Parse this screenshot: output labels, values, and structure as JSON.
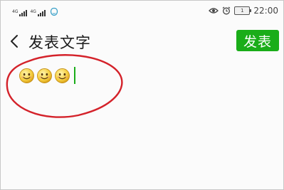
{
  "status_bar": {
    "sim1_label": "4G",
    "sim2_label": "4G",
    "time": "22:00",
    "battery_level": "1",
    "icons": [
      "signal-icon",
      "signal-icon",
      "chat-notification-icon",
      "eye-icon",
      "alarm-icon",
      "battery-icon"
    ]
  },
  "header": {
    "back_icon": "chevron-left-icon",
    "title": "发表文字",
    "publish_label": "发表"
  },
  "editor": {
    "emoji_count": 3,
    "emoji_icon": "smiley-emoji-icon"
  },
  "annotation": {
    "color": "#d4222a",
    "shape": "ellipse"
  },
  "colors": {
    "accent": "#1aad19",
    "background": "#fbfbfb"
  }
}
